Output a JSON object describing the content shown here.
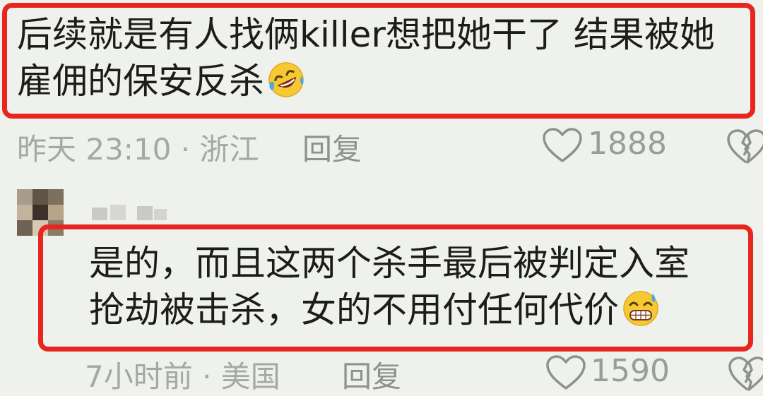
{
  "comments": [
    {
      "text_line1": "后续就是有人找俩killer想把她干了 结果被她",
      "text_line2": "雇佣的保安反杀",
      "emoji": "rolling-on-floor-laughing-emoji",
      "meta": "昨天 23:10 · 浙江",
      "reply_label": "回复",
      "like_count": "1888"
    },
    {
      "text_line1": "是的，而且这两个杀手最后被判定入室",
      "text_line2": "抢劫被击杀，女的不用付任何代价",
      "emoji": "grinning-sweat-emoji",
      "meta": "7小时前 · 美国",
      "reply_label": "回复",
      "like_count": "1590"
    }
  ],
  "colors": {
    "background": "#eef1ec",
    "highlight_border": "#e8251f",
    "meta_text": "#a6a8a4"
  }
}
